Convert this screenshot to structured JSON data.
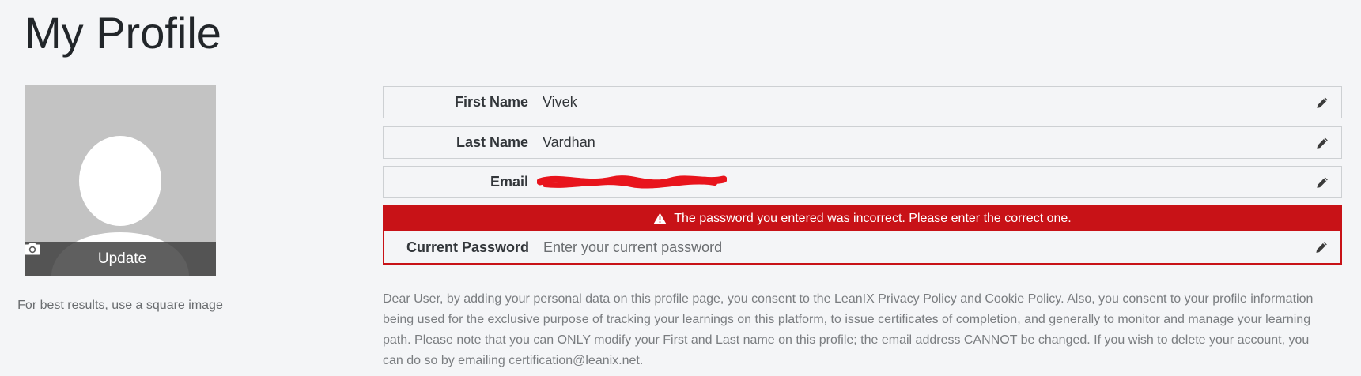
{
  "page": {
    "title": "My Profile"
  },
  "avatar": {
    "update_label": "Update",
    "hint": "For best results, use a square image"
  },
  "fields": {
    "first_name": {
      "label": "First Name",
      "value": "Vivek"
    },
    "last_name": {
      "label": "Last Name",
      "value": "Vardhan"
    },
    "email": {
      "label": "Email"
    },
    "current_password": {
      "label": "Current Password",
      "placeholder": "Enter your current password",
      "value": ""
    }
  },
  "error": {
    "message": "The password you entered was incorrect. Please enter the correct one."
  },
  "consent": {
    "text": "Dear User, by adding your personal data on this profile page, you consent to the LeanIX Privacy Policy and Cookie Policy. Also, you consent to your profile information being used for the exclusive purpose of tracking your learnings on this platform, to issue certificates of completion, and generally to monitor and manage your learning path. Please note that you can ONLY modify your First and Last name on this profile; the email address CANNOT be changed. If you wish to delete your account, you can do so by emailing certification@leanix.net."
  },
  "icons": {
    "edit": "pencil-icon",
    "camera": "camera-icon",
    "warning": "warning-icon"
  },
  "colors": {
    "error_red": "#c81217",
    "background": "#f4f5f7",
    "redaction": "#e8141c"
  }
}
